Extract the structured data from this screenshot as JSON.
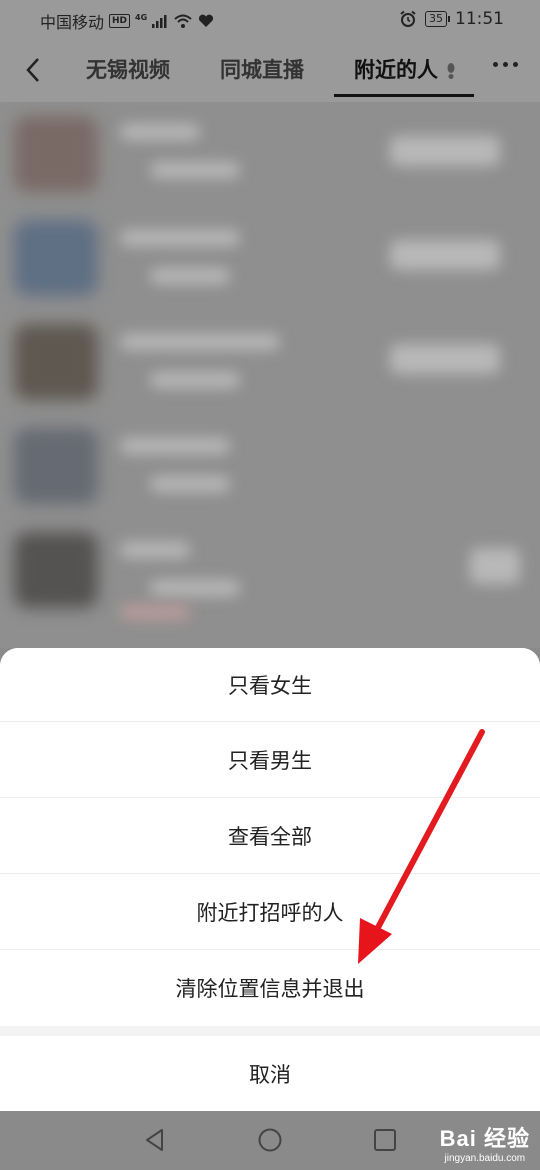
{
  "status_bar": {
    "carrier": "中国移动",
    "hd": "HD",
    "network": "4G",
    "battery": "35",
    "time": "11:51"
  },
  "nav": {
    "tabs": [
      {
        "label": "无锡视频",
        "active": false
      },
      {
        "label": "同城直播",
        "active": false
      },
      {
        "label": "附近的人",
        "active": true
      }
    ]
  },
  "sheet": {
    "options": [
      {
        "label": "只看女生"
      },
      {
        "label": "只看男生"
      },
      {
        "label": "查看全部"
      },
      {
        "label": "附近打招呼的人"
      },
      {
        "label": "清除位置信息并退出"
      }
    ],
    "cancel_label": "取消"
  },
  "colors": {
    "annotation_arrow": "#e8141b",
    "overlay_gray": "#8a8a8a",
    "sheet_bg": "#ffffff"
  },
  "watermark": {
    "brand": "Bai 经验",
    "url": "jingyan.baidu.com"
  }
}
